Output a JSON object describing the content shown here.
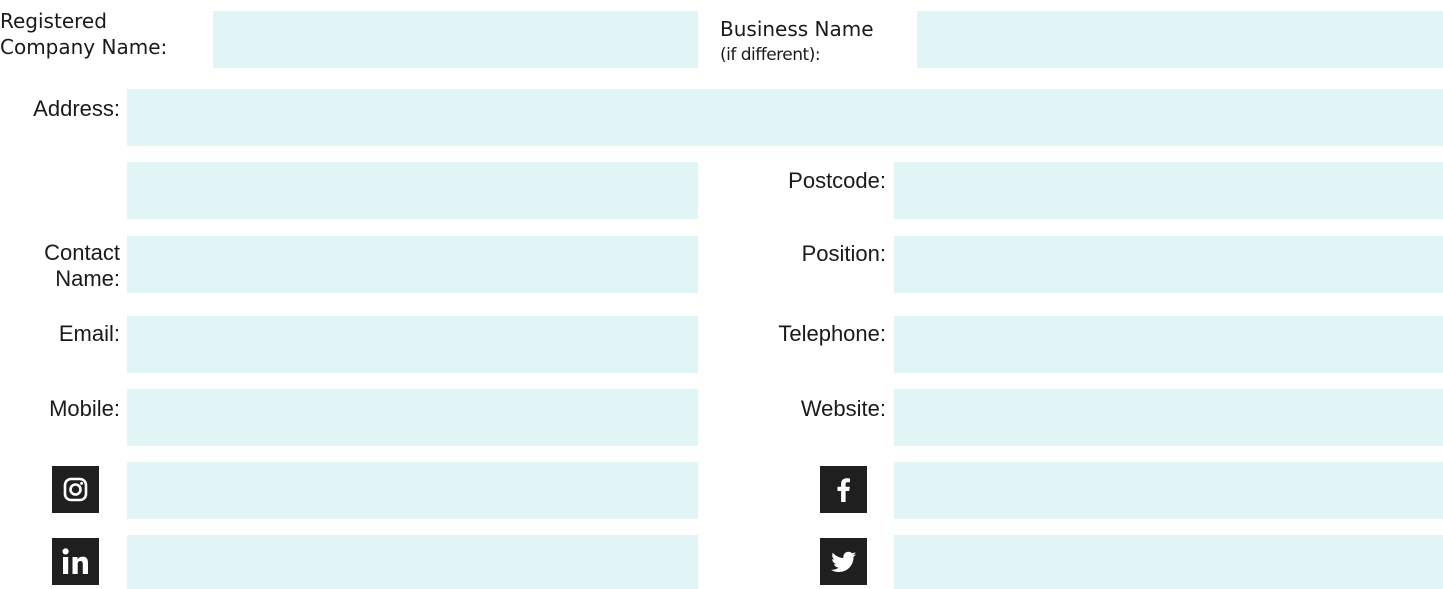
{
  "form": {
    "registered_company": {
      "label_line1": "Registered",
      "label_line2": "Company Name:",
      "value": ""
    },
    "business_name": {
      "label_line1": "Business Name",
      "label_line2": "(if different):",
      "value": ""
    },
    "address": {
      "label": "Address:",
      "line1": "",
      "line2": ""
    },
    "postcode": {
      "label": "Postcode:",
      "value": ""
    },
    "contact_name": {
      "label_line1": "Contact",
      "label_line2": "Name:",
      "value": ""
    },
    "position": {
      "label": "Position:",
      "value": ""
    },
    "email": {
      "label": "Email:",
      "value": ""
    },
    "telephone": {
      "label": "Telephone:",
      "value": ""
    },
    "mobile": {
      "label": "Mobile:",
      "value": ""
    },
    "website": {
      "label": "Website:",
      "value": ""
    },
    "instagram": {
      "icon": "instagram-icon",
      "value": ""
    },
    "facebook": {
      "icon": "facebook-icon",
      "value": ""
    },
    "linkedin": {
      "icon": "linkedin-icon",
      "value": ""
    },
    "twitter": {
      "icon": "twitter-icon",
      "value": ""
    }
  },
  "colors": {
    "field_background": "#e2f5f6",
    "icon_background": "#1f1f1f",
    "text": "#1a1a1a"
  }
}
